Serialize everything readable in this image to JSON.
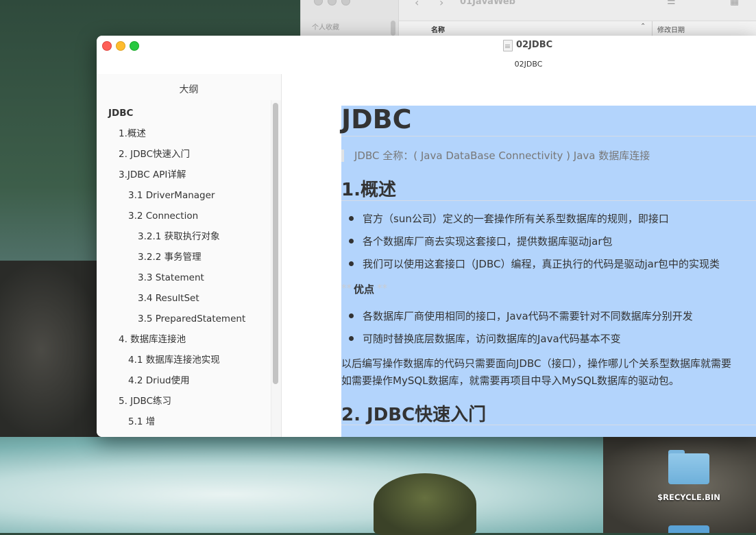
{
  "finder": {
    "favorites_label": "个人收藏",
    "folder_title": "01JavaWeb",
    "col_name": "名称",
    "col_date": "修改日期",
    "back_icon": "chevron-left-icon",
    "forward_icon": "chevron-right-icon"
  },
  "window": {
    "title": "02JDBC",
    "subtitle": "02JDBC"
  },
  "sidebar": {
    "title": "大纲",
    "items": [
      {
        "label": "JDBC",
        "level": 0
      },
      {
        "label": "1.概述",
        "level": 1
      },
      {
        "label": "2. JDBC快速入门",
        "level": 1
      },
      {
        "label": "3.JDBC API详解",
        "level": 1
      },
      {
        "label": "3.1 DriverManager",
        "level": 2
      },
      {
        "label": "3.2 Connection",
        "level": 2
      },
      {
        "label": "3.2.1 获取执行对象",
        "level": 3
      },
      {
        "label": "3.2.2 事务管理",
        "level": 3
      },
      {
        "label": "3.3 Statement",
        "level": 3
      },
      {
        "label": "3.4 ResultSet",
        "level": 3
      },
      {
        "label": "3.5 PreparedStatement",
        "level": 3
      },
      {
        "label": "4. 数据库连接池",
        "level": 1
      },
      {
        "label": "4.1 数据库连接池实现",
        "level": 2
      },
      {
        "label": "4.2 Driud使用",
        "level": 2
      },
      {
        "label": "5. JDBC练习",
        "level": 1
      },
      {
        "label": "5.1 增",
        "level": 2
      }
    ]
  },
  "content": {
    "h1": "JDBC",
    "blockquote": "JDBC 全称：( Java DataBase Connectivity ) Java 数据库连接",
    "section1": {
      "heading": "1.概述",
      "bullets": [
        "官方（sun公司）定义的一套操作所有关系型数据库的规则，即接口",
        "各个数据库厂商去实现这套接口，提供数据库驱动jar包",
        "我们可以使用这套接口（JDBC）编程，真正执行的代码是驱动jar包中的实现类"
      ],
      "advantages_marker": "**",
      "advantages_label": "优点",
      "advantages": [
        "各数据库厂商使用相同的接口，Java代码不需要针对不同数据库分别开发",
        "可随时替换底层数据库，访问数据库的Java代码基本不变"
      ],
      "paragraph_line1": "以后编写操作数据库的代码只需要面向JDBC（接口），操作哪儿个关系型数据库就需要",
      "paragraph_line2": "如需要操作MySQL数据库，就需要再项目中导入MySQL数据库的驱动包。"
    },
    "section2": {
      "heading": "2. JDBC快速入门"
    }
  },
  "desktop": {
    "folder_label": "$RECYCLE.BIN",
    "folder_icon": "folder-icon"
  },
  "colors": {
    "selection": "#b3d4fc",
    "close": "#fe5f57",
    "minimize": "#febc2e",
    "zoom": "#28c840"
  }
}
